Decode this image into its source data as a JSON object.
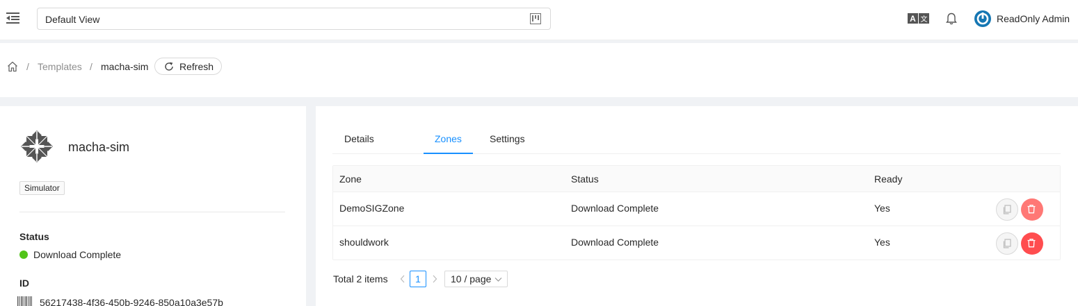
{
  "header": {
    "view_select_value": "Default View",
    "user_name": "ReadOnly Admin"
  },
  "breadcrumb": {
    "sep1": "/",
    "templates": "Templates",
    "sep2": "/",
    "current": "macha-sim",
    "refresh_label": "Refresh"
  },
  "left": {
    "name": "macha-sim",
    "tag": "Simulator",
    "status_label": "Status",
    "status_value": "Download Complete",
    "status_color": "#52c41a",
    "id_label": "ID",
    "id_value": "56217438-4f36-450b-9246-850a10a3e57b"
  },
  "tabs": [
    {
      "label": "Details",
      "active": false
    },
    {
      "label": "Zones",
      "active": true
    },
    {
      "label": "Settings",
      "active": false
    }
  ],
  "table": {
    "headers": [
      "Zone",
      "Status",
      "Ready"
    ],
    "rows": [
      {
        "zone": "DemoSIGZone",
        "status": "Download Complete",
        "ready": "Yes"
      },
      {
        "zone": "shouldwork",
        "status": "Download Complete",
        "ready": "Yes"
      }
    ]
  },
  "pagination": {
    "total": "Total 2 items",
    "current_page": "1",
    "page_size": "10 / page"
  },
  "colors": {
    "accent": "#1890ff",
    "danger": "#ff4d4f"
  },
  "icons": [
    "menu-fold-icon",
    "project-icon",
    "translate-icon",
    "bell-icon",
    "user-avatar-icon",
    "home-icon",
    "reload-icon",
    "template-os-logo",
    "barcode-icon",
    "copy-icon",
    "delete-icon",
    "left-icon",
    "right-icon",
    "down-icon"
  ]
}
